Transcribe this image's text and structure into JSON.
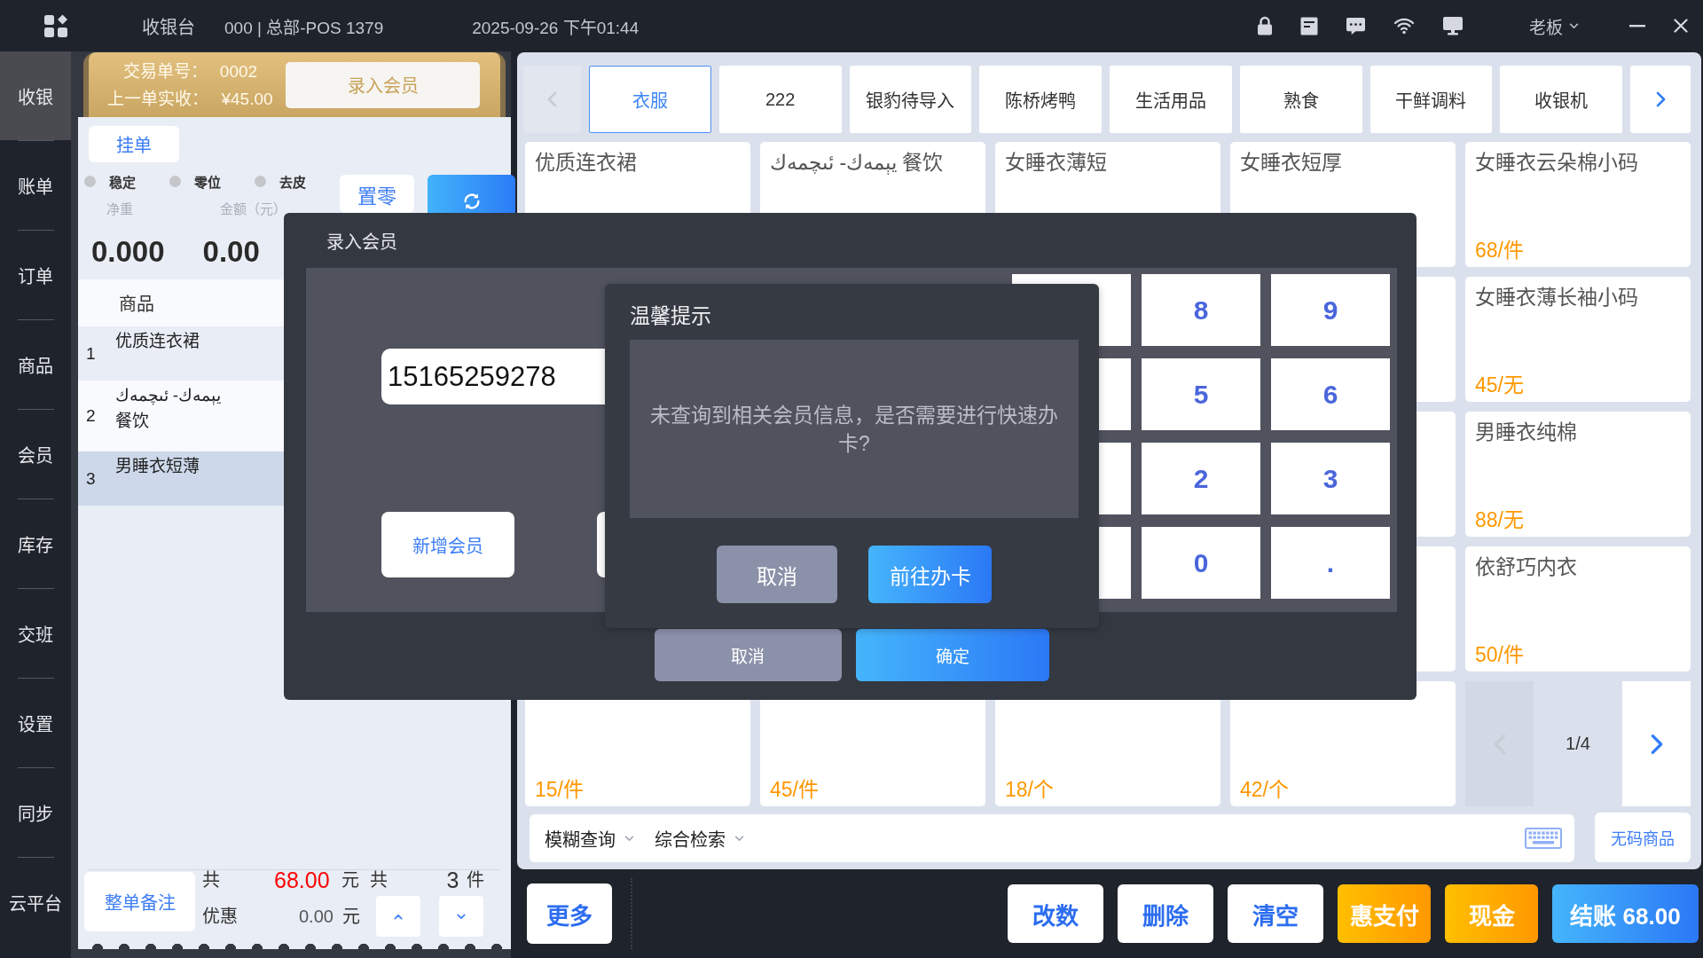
{
  "top_bar": {
    "app_title": "收银台",
    "terminal": "000 | 总部-POS 1379",
    "datetime": "2025-09-26 下午01:44",
    "user": "老板"
  },
  "sidebar": {
    "items": [
      {
        "label": "收银",
        "selected": true
      },
      {
        "label": "账单",
        "selected": false
      },
      {
        "label": "订单",
        "selected": false
      },
      {
        "label": "商品",
        "selected": false
      },
      {
        "label": "会员",
        "selected": false
      },
      {
        "label": "库存",
        "selected": false
      },
      {
        "label": "交班",
        "selected": false
      },
      {
        "label": "设置",
        "selected": false
      },
      {
        "label": "同步",
        "selected": false
      },
      {
        "label": "云平台",
        "selected": false
      }
    ]
  },
  "order_panel": {
    "trade_no_label": "交易单号：",
    "trade_no": "0002",
    "last_paid_label": "上一单实收：",
    "last_paid": "¥45.00",
    "member_button": "录入会员",
    "hold_button": "挂单",
    "scale_status": [
      {
        "label": "稳定",
        "on": false
      },
      {
        "label": "零位",
        "on": false
      },
      {
        "label": "去皮",
        "on": false
      }
    ],
    "zero_button": "置零",
    "net_weight_label": "净重",
    "amount_label": "金额（元）",
    "net_weight": "0.000",
    "amount": "0.00",
    "cart": {
      "columns": [
        "商品"
      ],
      "rows": [
        {
          "index": "1",
          "name": "优质连衣裙",
          "selected": false
        },
        {
          "index": "2",
          "name": "يېمەك- ئىچمەك 餐饮",
          "selected": false
        },
        {
          "index": "3",
          "name": "男睡衣短薄",
          "selected": true
        }
      ]
    },
    "note_button": "整单备注",
    "summary": {
      "total_label": "共",
      "total": "68.00",
      "total_unit": "元",
      "count_label": "共",
      "count": "3",
      "count_unit": "件",
      "discount_label": "优惠",
      "discount": "0.00",
      "discount_unit": "元"
    }
  },
  "categories": {
    "back": {
      "disabled": true
    },
    "forward": {
      "disabled": false
    },
    "tabs": [
      {
        "label": "衣服",
        "selected": true
      },
      {
        "label": "222",
        "selected": false
      },
      {
        "label": "银豹待导入",
        "selected": false
      },
      {
        "label": "陈桥烤鸭",
        "selected": false
      },
      {
        "label": "生活用品",
        "selected": false
      },
      {
        "label": "熟食",
        "selected": false
      },
      {
        "label": "干鲜调料",
        "selected": false
      },
      {
        "label": "收银机",
        "selected": false
      }
    ]
  },
  "products": [
    {
      "name": "优质连衣裙"
    },
    {
      "name": "يېمەك- ئىچمەك 餐饮"
    },
    {
      "name": "女睡衣薄短"
    },
    {
      "name": "女睡衣短厚"
    },
    {
      "name": "女睡衣云朵棉小码",
      "price": "68/件"
    },
    {
      "name": "女睡衣薄长袖小码",
      "price": "45/无"
    },
    {
      "name": "男睡衣纯棉",
      "price": "88/无"
    },
    {
      "name": "依舒巧内衣",
      "price": "50/件"
    },
    {
      "price": "15/件"
    },
    {
      "price": "45/件"
    },
    {
      "price": "18/个"
    },
    {
      "price": "42/个"
    }
  ],
  "pager": {
    "previous": {
      "disabled": true
    },
    "next": {
      "disabled": false
    },
    "page": "1/4"
  },
  "search": {
    "filters": [
      "模糊查询",
      "综合检索"
    ]
  },
  "no_code_button": "无码商品",
  "actions": {
    "more": "更多",
    "buttons": [
      {
        "label": "改数",
        "kind": "plain"
      },
      {
        "label": "删除",
        "kind": "plain"
      },
      {
        "label": "清空",
        "kind": "plain"
      },
      {
        "label": "惠支付",
        "kind": "accent"
      },
      {
        "label": "现金",
        "kind": "accent"
      },
      {
        "label": "结账 68.00",
        "kind": "primary"
      }
    ]
  },
  "member_dialog": {
    "title": "录入会员",
    "phone": "15165259278",
    "add_button": "新增会员",
    "keypad": [
      "8",
      "9",
      "5",
      "6",
      "2",
      "3",
      "0",
      "."
    ],
    "cancel": "取消",
    "confirm": "确定"
  },
  "alert": {
    "title": "温馨提示",
    "message": "未查询到相关会员信息，是否需要进行快速办卡?",
    "cancel": "取消",
    "confirm": "前往办卡"
  }
}
